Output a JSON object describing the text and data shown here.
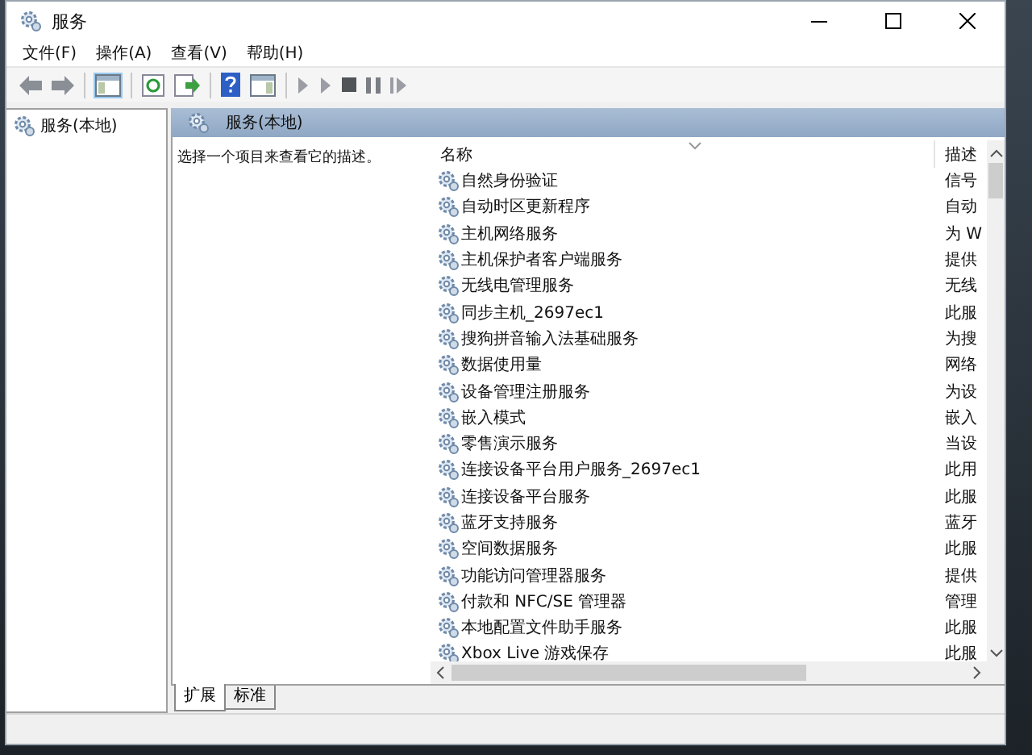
{
  "window": {
    "title": "服务"
  },
  "menu": [
    "文件(F)",
    "操作(A)",
    "查看(V)",
    "帮助(H)"
  ],
  "tree": {
    "items": [
      {
        "label": "服务(本地)"
      }
    ]
  },
  "panel": {
    "title": "服务(本地)",
    "description": "选择一个项目来查看它的描述。"
  },
  "table": {
    "columns": [
      "名称",
      "描述"
    ],
    "rows": [
      {
        "name": "自然身份验证",
        "description": "信号"
      },
      {
        "name": "自动时区更新程序",
        "description": "自动"
      },
      {
        "name": "主机网络服务",
        "description": "为 W"
      },
      {
        "name": "主机保护者客户端服务",
        "description": "提供"
      },
      {
        "name": "无线电管理服务",
        "description": "无线"
      },
      {
        "name": "同步主机_2697ec1",
        "description": "此服"
      },
      {
        "name": "搜狗拼音输入法基础服务",
        "description": "为搜"
      },
      {
        "name": "数据使用量",
        "description": "网络"
      },
      {
        "name": "设备管理注册服务",
        "description": "为设"
      },
      {
        "name": "嵌入模式",
        "description": "嵌入"
      },
      {
        "name": "零售演示服务",
        "description": "当设"
      },
      {
        "name": "连接设备平台用户服务_2697ec1",
        "description": "此用"
      },
      {
        "name": "连接设备平台服务",
        "description": "此服"
      },
      {
        "name": "蓝牙支持服务",
        "description": "蓝牙"
      },
      {
        "name": "空间数据服务",
        "description": "此服"
      },
      {
        "name": "功能访问管理器服务",
        "description": "提供"
      },
      {
        "name": "付款和 NFC/SE 管理器",
        "description": "管理"
      },
      {
        "name": "本地配置文件助手服务",
        "description": "此服"
      },
      {
        "name": "Xbox Live 游戏保存",
        "description": "此服"
      }
    ]
  },
  "tabs": [
    {
      "label": "扩展",
      "selected": true
    },
    {
      "label": "标准",
      "selected": false
    }
  ]
}
